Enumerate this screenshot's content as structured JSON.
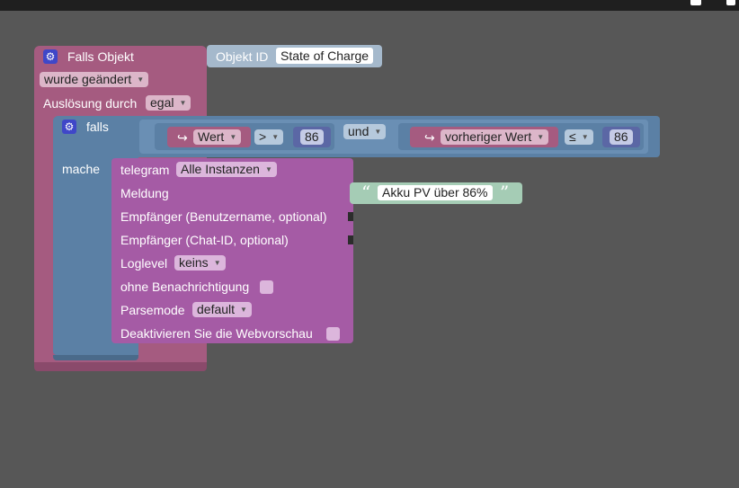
{
  "trigger": {
    "title": "Falls Objekt",
    "object_label": "Objekt ID",
    "object_value": "State of Charge",
    "mode": "wurde geändert",
    "trigger_by_label": "Auslösung durch",
    "trigger_by": "egal"
  },
  "if_block": {
    "label": "falls",
    "do_label": "mache",
    "cond1": {
      "prop": "Wert",
      "op": ">",
      "value": "86"
    },
    "logic": "und",
    "cond2": {
      "prop": "vorheriger Wert",
      "op": "≤",
      "value": "86"
    },
    "ref_icon": "↪"
  },
  "telegram": {
    "title": "telegram",
    "instance": "Alle Instanzen",
    "message_label": "Meldung",
    "message_text": "Akku PV über 86%",
    "quote_open": "“",
    "quote_close": "”",
    "recipient_user_label": "Empfänger (Benutzername, optional)",
    "recipient_chat_label": "Empfänger (Chat-ID, optional)",
    "loglevel_label": "Loglevel",
    "loglevel": "keins",
    "silent_label": "ohne Benachrichtigung",
    "parsemode_label": "Parsemode",
    "parsemode": "default",
    "disable_preview_label": "Deaktivieren Sie die Webvorschau"
  },
  "icons": {
    "gear": "gear-icon",
    "dropdown": "▼"
  },
  "colors": {
    "workspace": "#575757",
    "trigger_block": "#a55b80",
    "logic_block": "#5b80a5",
    "telegram_block": "#a55ba5",
    "text_block": "#a5ccb5",
    "number_block": "#5b67a5"
  }
}
